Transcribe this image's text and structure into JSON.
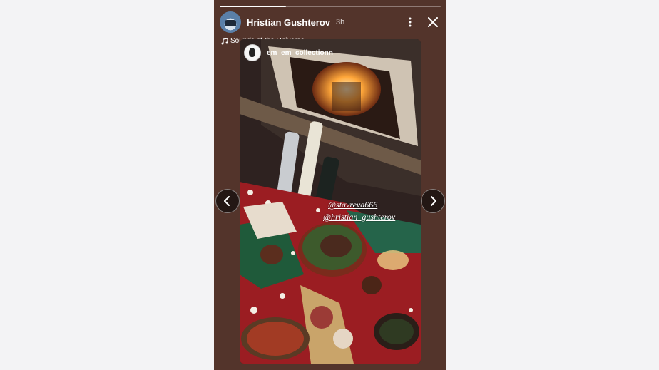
{
  "story": {
    "progress": 0.3,
    "username": "Hristian Gushterov",
    "time": "3h",
    "music": "Sounds of the Universe",
    "mention": {
      "account": "em_em_collectionn"
    },
    "tags": [
      "@stavreva666",
      "@hristian_gushterov"
    ]
  },
  "icons": {
    "more": "more-vertical-icon",
    "close": "close-icon",
    "music": "music-note-icon",
    "prev": "chevron-left-icon",
    "next": "chevron-right-icon"
  },
  "colors": {
    "story_bg": "#53342b",
    "page_bg": "#f3f3f5"
  }
}
